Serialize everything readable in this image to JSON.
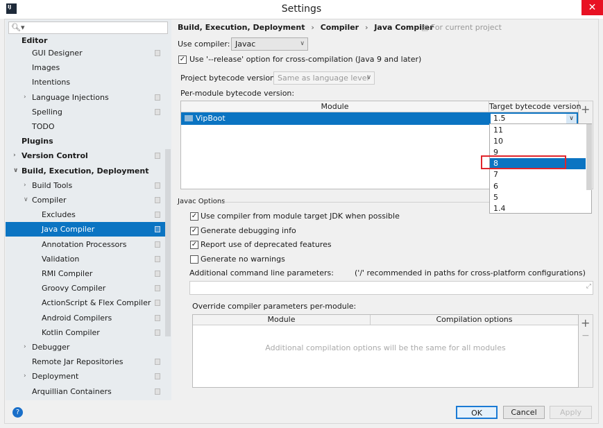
{
  "window": {
    "title": "Settings",
    "app_icon": "IJ"
  },
  "search": {
    "placeholder": ""
  },
  "sidebar": {
    "header": "Editor",
    "items": [
      {
        "label": "GUI Designer",
        "level": 2,
        "project": true
      },
      {
        "label": "Images",
        "level": 2
      },
      {
        "label": "Intentions",
        "level": 2
      },
      {
        "label": "Language Injections",
        "level": 2,
        "expandable": "collapsed",
        "project": true
      },
      {
        "label": "Spelling",
        "level": 2,
        "project": true
      },
      {
        "label": "TODO",
        "level": 2
      },
      {
        "label": "Plugins",
        "level": 1,
        "bold": true
      },
      {
        "label": "Version Control",
        "level": 1,
        "bold": true,
        "expandable": "collapsed",
        "project": true
      },
      {
        "label": "Build, Execution, Deployment",
        "level": 1,
        "bold": true,
        "expandable": "expanded"
      },
      {
        "label": "Build Tools",
        "level": 2,
        "expandable": "collapsed",
        "project": true
      },
      {
        "label": "Compiler",
        "level": 2,
        "expandable": "expanded",
        "project": true
      },
      {
        "label": "Excludes",
        "level": 3,
        "project": true
      },
      {
        "label": "Java Compiler",
        "level": 3,
        "project": true,
        "selected": true
      },
      {
        "label": "Annotation Processors",
        "level": 3,
        "project": true
      },
      {
        "label": "Validation",
        "level": 3,
        "project": true
      },
      {
        "label": "RMI Compiler",
        "level": 3,
        "project": true
      },
      {
        "label": "Groovy Compiler",
        "level": 3,
        "project": true
      },
      {
        "label": "ActionScript & Flex Compiler",
        "level": 3,
        "project": true
      },
      {
        "label": "Android Compilers",
        "level": 3,
        "project": true
      },
      {
        "label": "Kotlin Compiler",
        "level": 3,
        "project": true
      },
      {
        "label": "Debugger",
        "level": 2,
        "expandable": "collapsed"
      },
      {
        "label": "Remote Jar Repositories",
        "level": 2,
        "project": true
      },
      {
        "label": "Deployment",
        "level": 2,
        "expandable": "collapsed",
        "project": true
      },
      {
        "label": "Arquillian Containers",
        "level": 2,
        "project": true
      }
    ]
  },
  "breadcrumb": {
    "part1": "Build, Execution, Deployment",
    "part2": "Compiler",
    "part3": "Java Compiler",
    "sep": "›",
    "scope": "For current project"
  },
  "main": {
    "use_compiler_label": "Use compiler:",
    "use_compiler_value": "Javac",
    "release_option": {
      "label": "Use '--release' option for cross-compilation (Java 9 and later)",
      "checked": true
    },
    "project_bytecode_label": "Project bytecode version:",
    "project_bytecode_value": "Same as language level",
    "per_module_label": "Per-module bytecode version:",
    "module_table": {
      "col_module": "Module",
      "col_target": "Target bytecode version",
      "rows": [
        {
          "module": "VipBoot",
          "target": "1.5"
        }
      ]
    },
    "target_dropdown": {
      "options": [
        "11",
        "10",
        "9",
        "8",
        "7",
        "6",
        "5",
        "1.4"
      ],
      "highlighted": "8"
    },
    "javac_options_title": "Javac Options",
    "checkboxes": [
      {
        "label": "Use compiler from module target JDK when possible",
        "checked": true
      },
      {
        "label": "Generate debugging info",
        "checked": true
      },
      {
        "label": "Report use of deprecated features",
        "checked": true
      },
      {
        "label": "Generate no warnings",
        "checked": false
      }
    ],
    "additional_params_label": "Additional command line parameters:",
    "additional_params_hint": "('/' recommended in paths for cross-platform configurations)",
    "additional_params_value": "",
    "override_label": "Override compiler parameters per-module:",
    "override_table": {
      "col_module": "Module",
      "col_options": "Compilation options",
      "empty_text": "Additional compilation options will be the same for all modules"
    }
  },
  "buttons": {
    "ok": "OK",
    "cancel": "Cancel",
    "apply": "Apply",
    "help": "?",
    "add": "+",
    "remove": "−"
  },
  "colors": {
    "accent": "#0b74c2",
    "highlight_box": "#e0242b",
    "close": "#e81123"
  }
}
